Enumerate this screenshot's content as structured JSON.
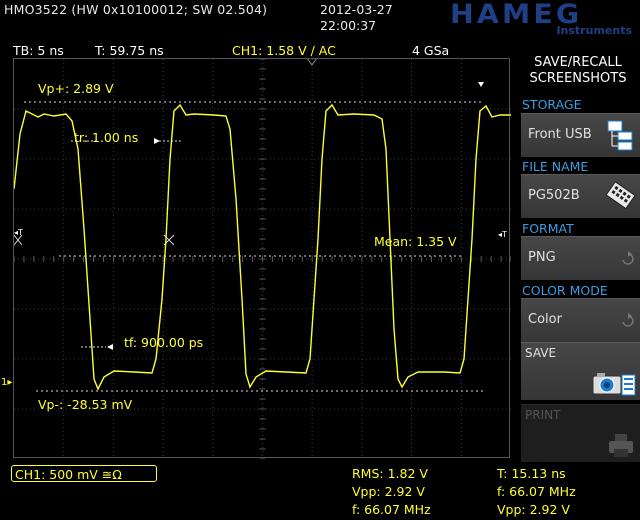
{
  "header": {
    "device": "HMO3522 (HW 0x10100012; SW 02.504)",
    "date": "2012-03-27",
    "time": "22:00:37",
    "logo_main": "HAMEG",
    "logo_sub": "Instruments"
  },
  "status": {
    "timebase": "TB: 5 ns",
    "trigger_time": "T: 59.75 ns",
    "channel_trigger": "CH1: 1.58 V ∕ AC",
    "sample_rate": "4 GSa"
  },
  "waveform": {
    "vp_plus": "Vp+: 2.89 V",
    "tr": "tr: 1.00 ns",
    "mean": "Mean: 1.35 V",
    "tf": "tf: 900.00 ps",
    "vp_minus": "Vp-: -28.53 mV",
    "trace_color": "#ffff30"
  },
  "footer": {
    "channel_scale": "CH1: 500 mV ≅Ω",
    "rms": "RMS: 1.82 V",
    "vpp1": "Vpp: 2.92 V",
    "freq1": "f: 66.07 MHz",
    "period": "T: 15.13 ns",
    "freq2": "f: 66.07 MHz",
    "vpp2": "Vpp: 2.92 V"
  },
  "menu": {
    "title_line1": "SAVE/RECALL",
    "title_line2": "SCREENSHOTS",
    "storage_label": "STORAGE",
    "storage_value": "Front USB",
    "filename_label": "FILE NAME",
    "filename_value": "PG502B",
    "format_label": "FORMAT",
    "format_value": "PNG",
    "colormode_label": "COLOR MODE",
    "colormode_value": "Color",
    "save_label": "SAVE",
    "print_label": "PRINT",
    "accent_color": "#3d9ce0",
    "icons": [
      "usb-folder-icon",
      "keyboard-icon",
      "rotary-icon",
      "camera-icon",
      "printer-icon"
    ]
  }
}
